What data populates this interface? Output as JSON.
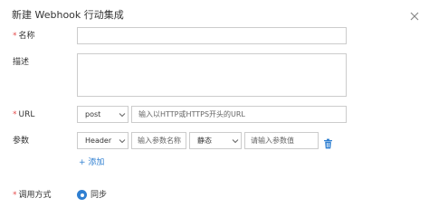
{
  "dialog": {
    "title": "新建 Webhook 行动集成",
    "close_icon": "close-icon"
  },
  "form": {
    "name": {
      "label": "名称",
      "required_mark": "*",
      "value": ""
    },
    "description": {
      "label": "描述",
      "value": ""
    },
    "url": {
      "label": "URL",
      "required_mark": "*",
      "method": "post",
      "placeholder": "输入以HTTP或HTTPS开头的URL"
    },
    "params": {
      "label": "参数",
      "row": {
        "type": "Header",
        "name_placeholder": "输入参数名称",
        "mode": "静态",
        "value_placeholder": "请输入参数值"
      },
      "add_label": "+ 添加"
    },
    "call_mode": {
      "label": "调用方式",
      "required_mark": "*",
      "selected_option": "同步"
    }
  },
  "colors": {
    "accent": "#2f7fd1",
    "required": "#e54b4b",
    "border": "#cccccc"
  }
}
